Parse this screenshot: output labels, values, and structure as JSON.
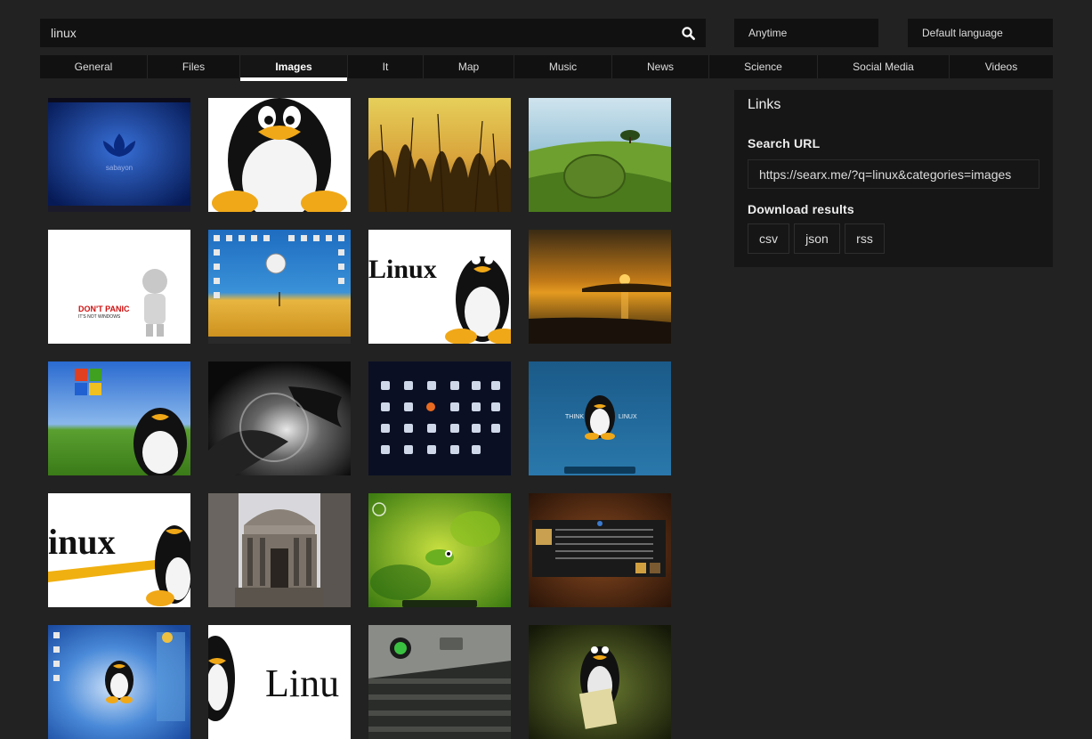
{
  "search": {
    "value": "linux"
  },
  "filters": {
    "time": "Anytime",
    "language": "Default language"
  },
  "tabs": [
    {
      "label": "General"
    },
    {
      "label": "Files"
    },
    {
      "label": "Images"
    },
    {
      "label": "It"
    },
    {
      "label": "Map"
    },
    {
      "label": "Music"
    },
    {
      "label": "News"
    },
    {
      "label": "Science"
    },
    {
      "label": "Social Media"
    },
    {
      "label": "Videos"
    }
  ],
  "active_tab": "Images",
  "sidebar": {
    "title": "Links",
    "search_url_label": "Search URL",
    "search_url": "https://searx.me/?q=linux&categories=images",
    "download_label": "Download results",
    "formats": [
      "csv",
      "json",
      "rss"
    ]
  },
  "thumbnail_text": {
    "sabayon": "sabayon",
    "dont_panic": "DON'T PANIC",
    "not_windows": "IT'S NOT WINDOWS",
    "linux_logo": "Linux",
    "inux_logo": "inux",
    "think": "THINK",
    "think_linux": "LINUX",
    "linu": "Linu"
  },
  "colors": {
    "background": "#222222",
    "bar": "#111111",
    "panel": "#161616",
    "active_tab_underline": "#ffffff"
  }
}
